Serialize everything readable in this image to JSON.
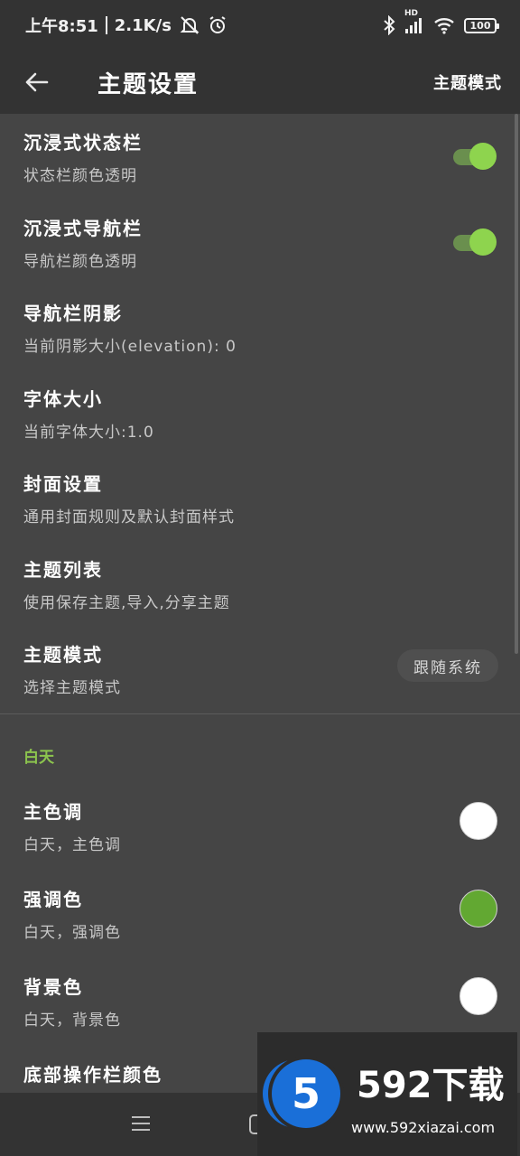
{
  "status_bar": {
    "time": "上午8:51",
    "net_speed": "2.1K/s",
    "battery": "100",
    "hd_label": "HD"
  },
  "app_bar": {
    "title": "主题设置",
    "action_label": "主题模式"
  },
  "settings": [
    {
      "title": "沉浸式状态栏",
      "subtitle": "状态栏颜色透明",
      "control": "switch",
      "on": true
    },
    {
      "title": "沉浸式导航栏",
      "subtitle": "导航栏颜色透明",
      "control": "switch",
      "on": true
    },
    {
      "title": "导航栏阴影",
      "subtitle": "当前阴影大小(elevation): 0"
    },
    {
      "title": "字体大小",
      "subtitle": "当前字体大小:1.0"
    },
    {
      "title": "封面设置",
      "subtitle": "通用封面规则及默认封面样式"
    },
    {
      "title": "主题列表",
      "subtitle": "使用保存主题,导入,分享主题"
    },
    {
      "title": "主题模式",
      "subtitle": "选择主题模式",
      "chip": "跟随系统"
    }
  ],
  "section": {
    "label": "白天",
    "items": [
      {
        "title": "主色调",
        "subtitle": "白天，主色调",
        "color": "#ffffff"
      },
      {
        "title": "强调色",
        "subtitle": "白天，强调色",
        "color": "#62a832"
      },
      {
        "title": "背景色",
        "subtitle": "白天，背景色",
        "color": "#ffffff"
      },
      {
        "title": "底部操作栏颜色",
        "subtitle": ""
      }
    ]
  },
  "watermark": {
    "badge": "5",
    "brand": "592下载",
    "url": "www.592xiazai.com"
  },
  "colors": {
    "accent_green": "#8ed44e",
    "section_green": "#8cc44e",
    "background": "#454545",
    "app_bar": "#333333"
  }
}
